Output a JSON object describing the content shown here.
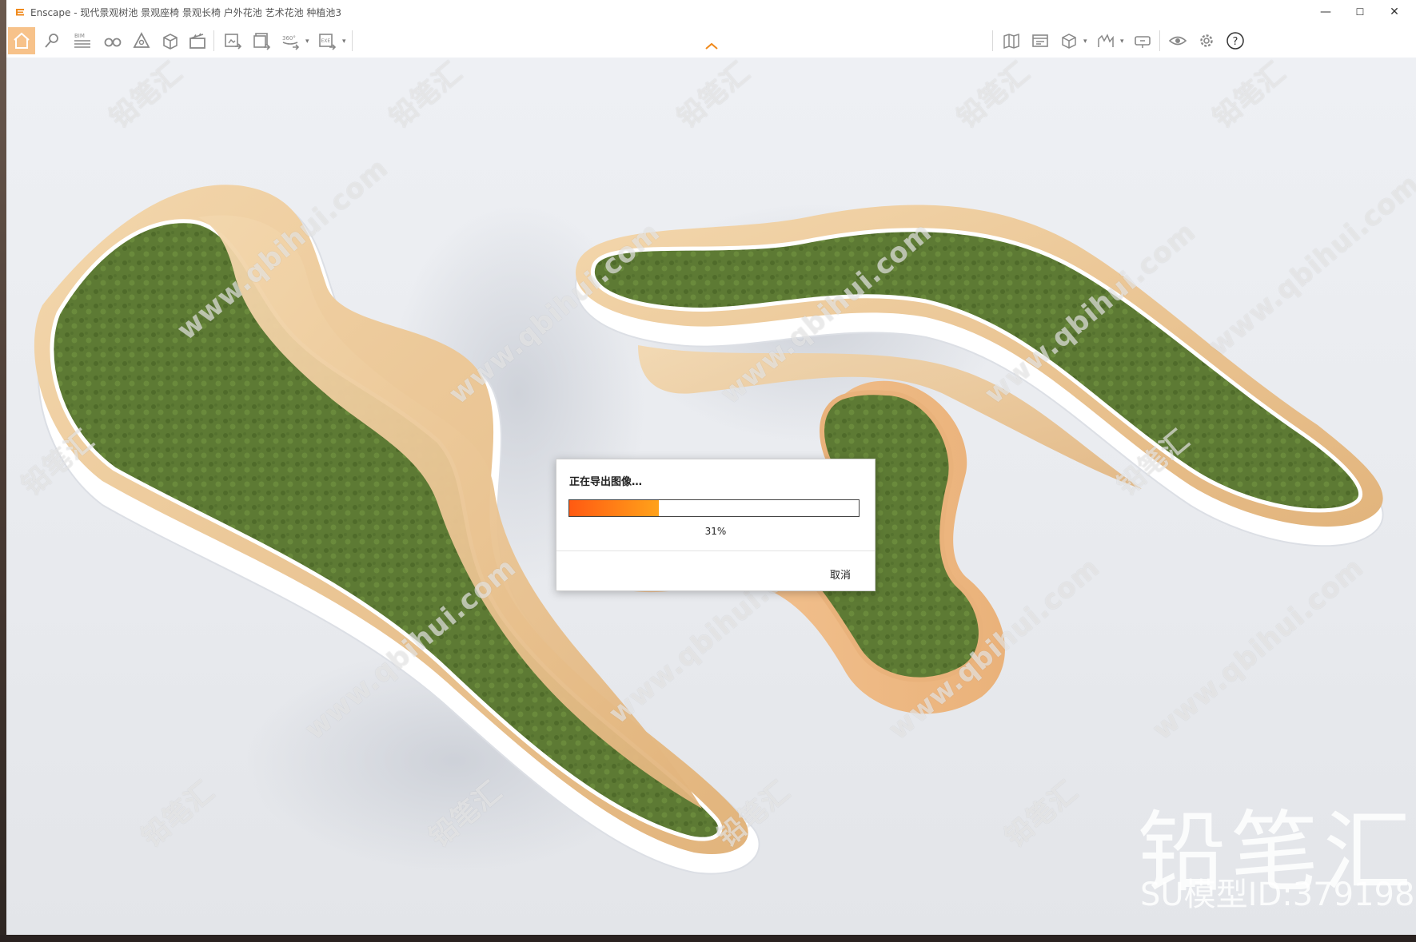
{
  "window": {
    "title": "Enscape - 现代景观树池 景观座椅 景观长椅 户外花池 艺术花池 种植池3",
    "minimize": "—",
    "maximize": "☐",
    "close": "✕"
  },
  "toolbar": {
    "left_buttons": [
      {
        "name": "home-icon",
        "active": true
      },
      {
        "name": "location-icon"
      },
      {
        "name": "bim-icon",
        "label": "BIM"
      },
      {
        "name": "binoculars-icon"
      },
      {
        "name": "material-icon"
      },
      {
        "name": "views-icon"
      },
      {
        "name": "clapper-icon"
      }
    ],
    "export_buttons": [
      {
        "name": "screenshot-export-icon"
      },
      {
        "name": "batch-export-icon"
      },
      {
        "name": "panorama-export-icon",
        "label": "360°"
      },
      {
        "name": "exe-export-icon",
        "label": "EXE"
      }
    ],
    "right_buttons": [
      {
        "name": "map-icon"
      },
      {
        "name": "gallery-icon"
      },
      {
        "name": "cube-icon"
      },
      {
        "name": "chart-icon"
      },
      {
        "name": "vr-headset-icon"
      },
      {
        "name": "eye-icon"
      },
      {
        "name": "settings-icon"
      },
      {
        "name": "help-icon",
        "label": "?"
      }
    ]
  },
  "accent_color": "#f08a1c",
  "dialog": {
    "title": "正在导出图像…",
    "progress": 0.31,
    "progress_text": "31%",
    "cancel_label": "取消"
  },
  "watermark": {
    "brand": "铅笔汇",
    "url": "www.qbihui.com",
    "model_id": "SU模型ID:379198"
  }
}
